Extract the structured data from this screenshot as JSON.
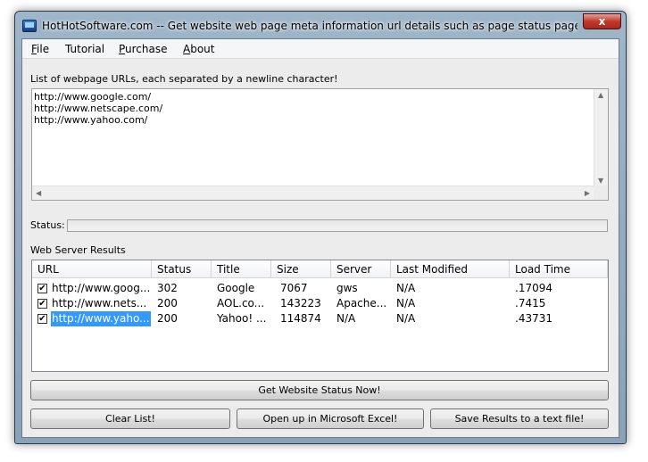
{
  "window": {
    "title": "HotHotSoftware.com -- Get website web page meta information url details such as page status page size web s...",
    "close_glyph": "x"
  },
  "menu": [
    {
      "label": "File",
      "hotkey": "F",
      "rest": "ile"
    },
    {
      "label": "Tutorial",
      "hotkey": "",
      "rest": "Tutorial"
    },
    {
      "label": "Purchase",
      "hotkey": "P",
      "rest": "urchase"
    },
    {
      "label": "About",
      "hotkey": "A",
      "rest": "bout"
    }
  ],
  "urls_label": "List of webpage URLs, each separated by a newline character!",
  "urls": [
    "http://www.google.com/",
    "http://www.netscape.com/",
    "http://www.yahoo.com/"
  ],
  "status_label": "Status:",
  "results_label": "Web Server Results",
  "columns": [
    "URL",
    "Status",
    "Title",
    "Size",
    "Server",
    "Last Modified",
    "Load Time"
  ],
  "rows": [
    {
      "checked": "✔",
      "url": "http://www.goog...",
      "status": "302",
      "title": "Google",
      "size": "7067",
      "server": "gws",
      "modified": "N/A",
      "load": ".17094"
    },
    {
      "checked": "✔",
      "url": "http://www.nets...",
      "status": "200",
      "title": "AOL.co...",
      "size": "143223",
      "server": "Apache...",
      "modified": "N/A",
      "load": ".7415"
    },
    {
      "checked": "✔",
      "url": "http://www.yaho...",
      "status": "200",
      "title": "Yahoo! ...",
      "size": "114874",
      "server": "N/A",
      "modified": "N/A",
      "load": ".43731"
    }
  ],
  "buttons": {
    "get_status": "Get Website Status Now!",
    "clear": "Clear List!",
    "excel": "Open up in Microsoft Excel!",
    "save": "Save Results to a text file!"
  }
}
